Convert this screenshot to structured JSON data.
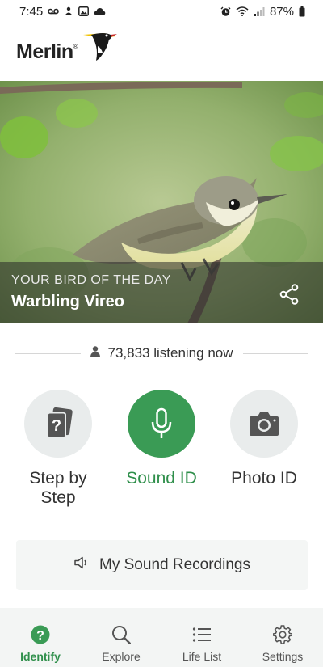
{
  "status_bar": {
    "time": "7:45",
    "battery": "87%"
  },
  "header": {
    "app_name": "Merlin",
    "trademark": "®"
  },
  "hero": {
    "kicker": "YOUR BIRD OF THE DAY",
    "bird_name": "Warbling Vireo"
  },
  "listening": {
    "text": "73,833 listening now"
  },
  "actions": [
    {
      "label": "Step by Step",
      "icon": "cards-question-icon"
    },
    {
      "label": "Sound ID",
      "icon": "microphone-icon"
    },
    {
      "label": "Photo ID",
      "icon": "camera-icon"
    }
  ],
  "recordings": {
    "label": "My Sound Recordings",
    "icon": "speaker-icon"
  },
  "bottom_nav": {
    "active": "Identify",
    "items": [
      {
        "label": "Identify",
        "icon": "question-circle-icon"
      },
      {
        "label": "Explore",
        "icon": "search-icon"
      },
      {
        "label": "Life List",
        "icon": "list-icon"
      },
      {
        "label": "Settings",
        "icon": "gear-icon"
      }
    ]
  },
  "colors": {
    "accent": "#3a9b55",
    "accent_text": "#2f8f4b",
    "circle_bg": "#e9ecec",
    "nav_bg": "#f3f5f4"
  }
}
